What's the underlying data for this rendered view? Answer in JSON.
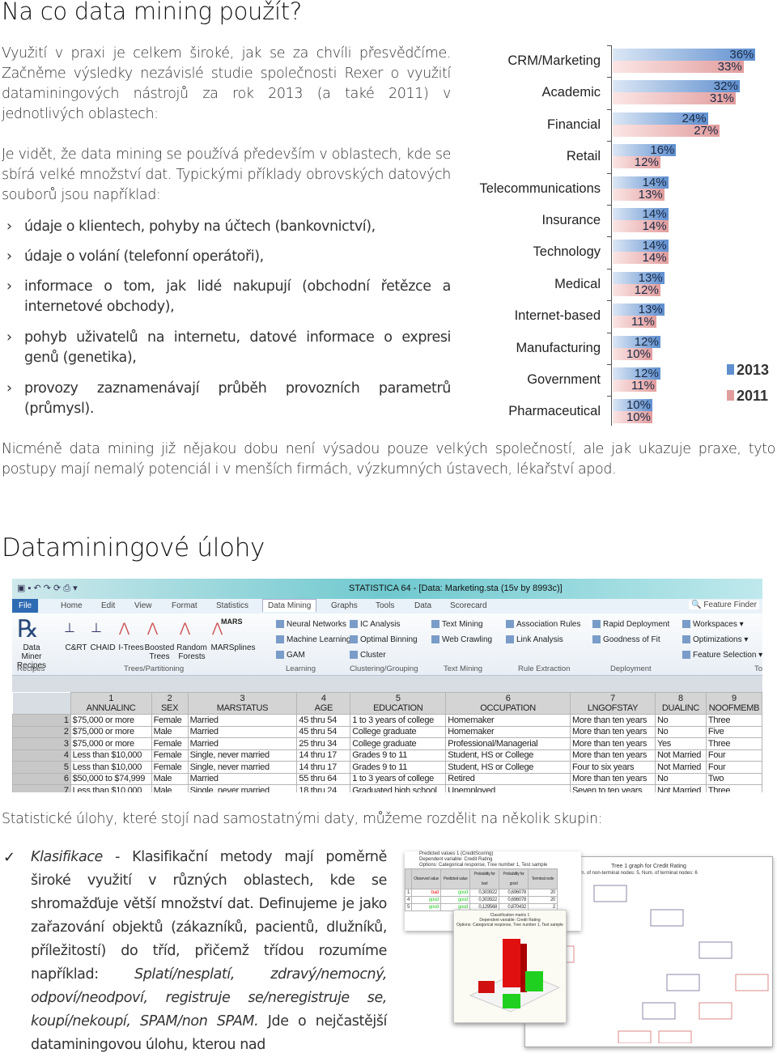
{
  "section1": {
    "title": "Na co data mining použít?",
    "para1": "Využití v praxi je celkem široké, jak se za chvíli přesvědčíme. Začněme výsledky nezávislé studie společnosti Rexer o využití dataminingových nástrojů za rok 2013 (a také 2011) v jednotlivých oblastech:",
    "para2": "Je vidět, že data mining se používá především v oblastech, kde se sbírá velké množství dat. Typickými příklady obrovských datových souborů jsou například:",
    "bullet_marker": "›",
    "bullets": [
      "údaje o klientech, pohyby na účtech (bankovnictví),",
      "údaje o volání (telefonní operátoři),",
      "informace o tom, jak lidé nakupují (obchodní řetězce a internetové obchody),",
      "pohyb uživatelů na internetu, datové informace o expresi genů (genetika),",
      "provozy zaznamenávají průběh provozních parametrů (průmysl)."
    ],
    "para3": "Nicméně data mining již nějakou dobu není výsadou pouze velkých společností, ale jak ukazuje praxe, tyto postupy mají nemalý potenciál i v menších firmách, výzkumných ústavech, lékařství apod."
  },
  "chart_data": {
    "type": "bar",
    "orientation": "horizontal",
    "categories": [
      "CRM/Marketing",
      "Academic",
      "Financial",
      "Retail",
      "Telecommunications",
      "Insurance",
      "Technology",
      "Medical",
      "Internet-based",
      "Manufacturing",
      "Government",
      "Pharmaceutical"
    ],
    "series": [
      {
        "name": "2013",
        "color": "#5f8fcf",
        "values": [
          36,
          32,
          24,
          16,
          14,
          14,
          14,
          13,
          13,
          12,
          12,
          10
        ]
      },
      {
        "name": "2011",
        "color": "#e29d9d",
        "values": [
          33,
          31,
          27,
          12,
          13,
          14,
          14,
          12,
          11,
          10,
          11,
          10
        ]
      }
    ],
    "value_suffix": "%",
    "legend_position": "right",
    "grid": false
  },
  "section2": {
    "title": "Dataminingové úlohy",
    "intro": "Statistické úlohy, které stojí nad samostatnými daty, můžeme rozdělit na několik skupin:",
    "check_marker": "✓",
    "klasifikace_term": "Klasifikace",
    "klasifikace_text1": " - Klasifikační metody mají poměrně široké využití v různých oblastech, kde se shromažďuje větší množství dat. Definujeme je jako zařazování objektů (zákazníků, pacientů, dlužníků, příležitostí) do tříd, přičemž třídou rozumíme například: ",
    "klasifikace_examples": "Splatí/nesplatí, zdravý/nemocný, odpoví/neodpoví, registruje se/neregistruje se, koupí/nekoupí, SPAM/non SPAM.",
    "klasifikace_text2": " Jde o nejčastější dataminingovou úlohu, kterou nad"
  },
  "statistica": {
    "window_title": "STATISTICA 64 - [Data: Marketing.sta (15v by 8993c)]",
    "tabs": [
      "File",
      "Home",
      "Edit",
      "View",
      "Format",
      "Statistics",
      "Data Mining",
      "Graphs",
      "Tools",
      "Data",
      "Scorecard"
    ],
    "active_tab": "Data Mining",
    "feature_finder": "Feature Finder",
    "ribbon": {
      "recipes": "Data Miner Recipes",
      "trees": [
        "C&RT",
        "CHAID",
        "I-Trees",
        "Boosted Trees",
        "Random Forests",
        "MARSplines"
      ],
      "mars_label": "MARS",
      "learning": [
        "Neural Networks",
        "Machine Learning",
        "GAM"
      ],
      "clustering": [
        "IC Analysis",
        "Optimal Binning",
        "Cluster"
      ],
      "textmining": [
        "Text Mining",
        "Web Crawling"
      ],
      "rules": [
        "Association Rules",
        "Link Analysis"
      ],
      "deployment": [
        "Rapid Deployment",
        "Goodness of Fit"
      ],
      "tools": [
        "Workspaces ▾",
        "Optimizations ▾",
        "Feature Selection ▾"
      ],
      "groups": [
        "Recipes",
        "Trees/Partitioning",
        "Learning",
        "Clustering/Grouping",
        "Text Mining",
        "Rule Extraction",
        "Deployment",
        "To"
      ]
    },
    "columns": [
      {
        "num": "1",
        "name": "ANNUALINC"
      },
      {
        "num": "2",
        "name": "SEX"
      },
      {
        "num": "3",
        "name": "MARSTATUS"
      },
      {
        "num": "4",
        "name": "AGE"
      },
      {
        "num": "5",
        "name": "EDUCATION"
      },
      {
        "num": "6",
        "name": "OCCUPATION"
      },
      {
        "num": "7",
        "name": "LNGOFSTAY"
      },
      {
        "num": "8",
        "name": "DUALINC"
      },
      {
        "num": "9",
        "name": "NOOFMEMB"
      }
    ],
    "rows": [
      [
        "1",
        "$75,000 or more",
        "Female",
        "Married",
        "45 thru 54",
        "1 to 3 years of college",
        "Homemaker",
        "More than ten years",
        "No",
        "Three"
      ],
      [
        "2",
        "$75,000 or more",
        "Male",
        "Married",
        "45 thru 54",
        "College graduate",
        "Homemaker",
        "More than ten years",
        "No",
        "Five"
      ],
      [
        "3",
        "$75,000 or more",
        "Female",
        "Married",
        "25 thru 34",
        "College graduate",
        "Professional/Managerial",
        "More than ten years",
        "Yes",
        "Three"
      ],
      [
        "4",
        "Less than $10,000",
        "Female",
        "Single, never married",
        "14 thru 17",
        "Grades 9 to 11",
        "Student, HS or College",
        "More than ten years",
        "Not Married",
        "Four"
      ],
      [
        "5",
        "Less than $10,000",
        "Female",
        "Single, never married",
        "14 thru 17",
        "Grades 9 to 11",
        "Student, HS or College",
        "Four to six years",
        "Not Married",
        "Four"
      ],
      [
        "6",
        "$50,000 to $74,999",
        "Male",
        "Married",
        "55 thru 64",
        "1 to 3 years of college",
        "Retired",
        "More than ten years",
        "No",
        "Two"
      ],
      [
        "7",
        "Less than $10,000",
        "Male",
        "Single, never married",
        "18 thru 24",
        "Graduated high school",
        "Unemployed",
        "Seven to ten years",
        "Not Married",
        "Three"
      ]
    ]
  },
  "classification_shot": {
    "pred_title": [
      "Predicted values 1 (CreditScoring)",
      "Dependent variable: Credit Rating",
      "Options: Categorical response, Tree number 1, Test sample"
    ],
    "pred_headers": [
      "Observed value",
      "Predicted value",
      "Probability for bad",
      "Probability for good",
      "Terminal node"
    ],
    "pred_rows": [
      [
        "1",
        "bad",
        "good",
        "0,303922",
        "0,696078",
        "20"
      ],
      [
        "4",
        "good",
        "good",
        "0,303922",
        "0,696078",
        "20"
      ],
      [
        "5",
        "good",
        "good",
        "0,129568",
        "0,870432",
        "2"
      ]
    ],
    "matrix_title": [
      "Classification matrix 1",
      "Dependent variable: Credit Rating",
      "Options: Categorical response, Tree number 1, Test sample"
    ],
    "tree_title": "Tree 1 graph for Credit Rating",
    "tree_subtitle": "Num. of non-terminal nodes: 5,  Num. of terminal nodes: 6"
  }
}
